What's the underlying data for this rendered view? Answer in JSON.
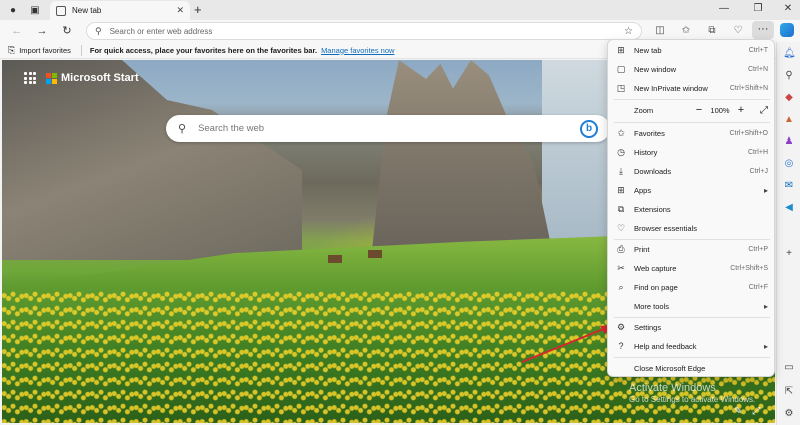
{
  "tab": {
    "title": "New tab"
  },
  "address": {
    "placeholder": "Search or enter web address"
  },
  "favorites_bar": {
    "import_label": "Import favorites",
    "message": "For quick access, place your favorites here on the favorites bar.",
    "manage_link": "Manage favorites now"
  },
  "start": {
    "brand": "Microsoft Start",
    "search_placeholder": "Search the web",
    "bing_letter": "b"
  },
  "menu": {
    "new_tab": {
      "label": "New tab",
      "shortcut": "Ctrl+T"
    },
    "new_window": {
      "label": "New window",
      "shortcut": "Ctrl+N"
    },
    "new_inprivate": {
      "label": "New InPrivate window",
      "shortcut": "Ctrl+Shift+N"
    },
    "zoom": {
      "label": "Zoom",
      "minus": "−",
      "value": "100%",
      "plus": "+"
    },
    "favorites": {
      "label": "Favorites",
      "shortcut": "Ctrl+Shift+O"
    },
    "history": {
      "label": "History",
      "shortcut": "Ctrl+H"
    },
    "downloads": {
      "label": "Downloads",
      "shortcut": "Ctrl+J"
    },
    "apps": {
      "label": "Apps"
    },
    "extensions": {
      "label": "Extensions"
    },
    "browser_essentials": {
      "label": "Browser essentials"
    },
    "print": {
      "label": "Print",
      "shortcut": "Ctrl+P"
    },
    "web_capture": {
      "label": "Web capture",
      "shortcut": "Ctrl+Shift+S"
    },
    "find_on_page": {
      "label": "Find on page",
      "shortcut": "Ctrl+F"
    },
    "more_tools": {
      "label": "More tools"
    },
    "settings": {
      "label": "Settings"
    },
    "help": {
      "label": "Help and feedback"
    },
    "close": {
      "label": "Close Microsoft Edge"
    }
  },
  "watermark": {
    "title": "Activate Windows",
    "subtitle": "Go to Settings to activate Windows."
  },
  "colors": {
    "accent": "#0f6cbd",
    "annotation_arrow": "#d9262c"
  }
}
